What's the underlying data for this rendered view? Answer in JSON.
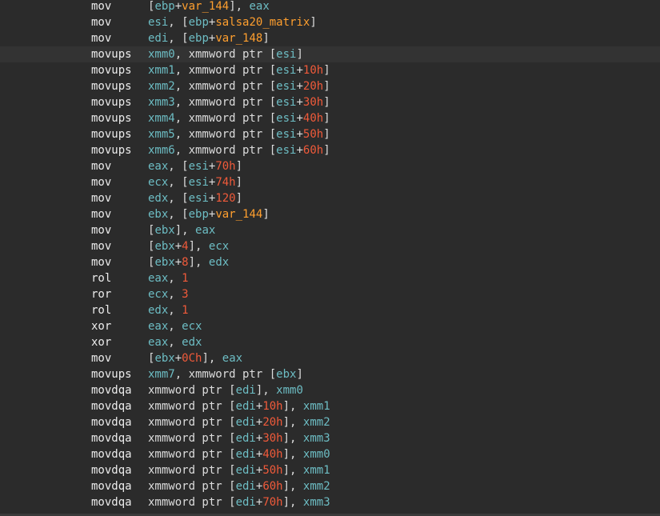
{
  "colors": {
    "background": "#2b2b2b",
    "current_line": "#333333",
    "mnemonic": "#ececec",
    "text": "#dcdcdc",
    "register": "#6dbdc4",
    "variable": "#ff9f2e",
    "number": "#f05a3a"
  },
  "current_line_index": 3,
  "lines": [
    {
      "mnemonic": "mov",
      "tokens": [
        [
          "t",
          "["
        ],
        [
          "r",
          "ebp"
        ],
        [
          "t",
          "+"
        ],
        [
          "v",
          "var_144"
        ],
        [
          "t",
          "], "
        ],
        [
          "r",
          "eax"
        ]
      ]
    },
    {
      "mnemonic": "mov",
      "tokens": [
        [
          "r",
          "esi"
        ],
        [
          "t",
          ", ["
        ],
        [
          "r",
          "ebp"
        ],
        [
          "t",
          "+"
        ],
        [
          "v",
          "salsa20_matrix"
        ],
        [
          "t",
          "]"
        ]
      ]
    },
    {
      "mnemonic": "mov",
      "tokens": [
        [
          "r",
          "edi"
        ],
        [
          "t",
          ", ["
        ],
        [
          "r",
          "ebp"
        ],
        [
          "t",
          "+"
        ],
        [
          "v",
          "var_148"
        ],
        [
          "t",
          "]"
        ]
      ]
    },
    {
      "mnemonic": "movups",
      "tokens": [
        [
          "r",
          "xmm0"
        ],
        [
          "t",
          ", xmmword ptr ["
        ],
        [
          "r",
          "esi"
        ],
        [
          "t",
          "]"
        ]
      ]
    },
    {
      "mnemonic": "movups",
      "tokens": [
        [
          "r",
          "xmm1"
        ],
        [
          "t",
          ", xmmword ptr ["
        ],
        [
          "r",
          "esi"
        ],
        [
          "t",
          "+"
        ],
        [
          "n",
          "10h"
        ],
        [
          "t",
          "]"
        ]
      ]
    },
    {
      "mnemonic": "movups",
      "tokens": [
        [
          "r",
          "xmm2"
        ],
        [
          "t",
          ", xmmword ptr ["
        ],
        [
          "r",
          "esi"
        ],
        [
          "t",
          "+"
        ],
        [
          "n",
          "20h"
        ],
        [
          "t",
          "]"
        ]
      ]
    },
    {
      "mnemonic": "movups",
      "tokens": [
        [
          "r",
          "xmm3"
        ],
        [
          "t",
          ", xmmword ptr ["
        ],
        [
          "r",
          "esi"
        ],
        [
          "t",
          "+"
        ],
        [
          "n",
          "30h"
        ],
        [
          "t",
          "]"
        ]
      ]
    },
    {
      "mnemonic": "movups",
      "tokens": [
        [
          "r",
          "xmm4"
        ],
        [
          "t",
          ", xmmword ptr ["
        ],
        [
          "r",
          "esi"
        ],
        [
          "t",
          "+"
        ],
        [
          "n",
          "40h"
        ],
        [
          "t",
          "]"
        ]
      ]
    },
    {
      "mnemonic": "movups",
      "tokens": [
        [
          "r",
          "xmm5"
        ],
        [
          "t",
          ", xmmword ptr ["
        ],
        [
          "r",
          "esi"
        ],
        [
          "t",
          "+"
        ],
        [
          "n",
          "50h"
        ],
        [
          "t",
          "]"
        ]
      ]
    },
    {
      "mnemonic": "movups",
      "tokens": [
        [
          "r",
          "xmm6"
        ],
        [
          "t",
          ", xmmword ptr ["
        ],
        [
          "r",
          "esi"
        ],
        [
          "t",
          "+"
        ],
        [
          "n",
          "60h"
        ],
        [
          "t",
          "]"
        ]
      ]
    },
    {
      "mnemonic": "mov",
      "tokens": [
        [
          "r",
          "eax"
        ],
        [
          "t",
          ", ["
        ],
        [
          "r",
          "esi"
        ],
        [
          "t",
          "+"
        ],
        [
          "n",
          "70h"
        ],
        [
          "t",
          "]"
        ]
      ]
    },
    {
      "mnemonic": "mov",
      "tokens": [
        [
          "r",
          "ecx"
        ],
        [
          "t",
          ", ["
        ],
        [
          "r",
          "esi"
        ],
        [
          "t",
          "+"
        ],
        [
          "n",
          "74h"
        ],
        [
          "t",
          "]"
        ]
      ]
    },
    {
      "mnemonic": "mov",
      "tokens": [
        [
          "r",
          "edx"
        ],
        [
          "t",
          ", ["
        ],
        [
          "r",
          "esi"
        ],
        [
          "t",
          "+"
        ],
        [
          "n",
          "120"
        ],
        [
          "t",
          "]"
        ]
      ]
    },
    {
      "mnemonic": "mov",
      "tokens": [
        [
          "r",
          "ebx"
        ],
        [
          "t",
          ", ["
        ],
        [
          "r",
          "ebp"
        ],
        [
          "t",
          "+"
        ],
        [
          "v",
          "var_144"
        ],
        [
          "t",
          "]"
        ]
      ]
    },
    {
      "mnemonic": "mov",
      "tokens": [
        [
          "t",
          "["
        ],
        [
          "r",
          "ebx"
        ],
        [
          "t",
          "], "
        ],
        [
          "r",
          "eax"
        ]
      ]
    },
    {
      "mnemonic": "mov",
      "tokens": [
        [
          "t",
          "["
        ],
        [
          "r",
          "ebx"
        ],
        [
          "t",
          "+"
        ],
        [
          "n",
          "4"
        ],
        [
          "t",
          "], "
        ],
        [
          "r",
          "ecx"
        ]
      ]
    },
    {
      "mnemonic": "mov",
      "tokens": [
        [
          "t",
          "["
        ],
        [
          "r",
          "ebx"
        ],
        [
          "t",
          "+"
        ],
        [
          "n",
          "8"
        ],
        [
          "t",
          "], "
        ],
        [
          "r",
          "edx"
        ]
      ]
    },
    {
      "mnemonic": "rol",
      "tokens": [
        [
          "r",
          "eax"
        ],
        [
          "t",
          ", "
        ],
        [
          "n",
          "1"
        ]
      ]
    },
    {
      "mnemonic": "ror",
      "tokens": [
        [
          "r",
          "ecx"
        ],
        [
          "t",
          ", "
        ],
        [
          "n",
          "3"
        ]
      ]
    },
    {
      "mnemonic": "rol",
      "tokens": [
        [
          "r",
          "edx"
        ],
        [
          "t",
          ", "
        ],
        [
          "n",
          "1"
        ]
      ]
    },
    {
      "mnemonic": "xor",
      "tokens": [
        [
          "r",
          "eax"
        ],
        [
          "t",
          ", "
        ],
        [
          "r",
          "ecx"
        ]
      ]
    },
    {
      "mnemonic": "xor",
      "tokens": [
        [
          "r",
          "eax"
        ],
        [
          "t",
          ", "
        ],
        [
          "r",
          "edx"
        ]
      ]
    },
    {
      "mnemonic": "mov",
      "tokens": [
        [
          "t",
          "["
        ],
        [
          "r",
          "ebx"
        ],
        [
          "t",
          "+"
        ],
        [
          "n",
          "0Ch"
        ],
        [
          "t",
          "], "
        ],
        [
          "r",
          "eax"
        ]
      ]
    },
    {
      "mnemonic": "movups",
      "tokens": [
        [
          "r",
          "xmm7"
        ],
        [
          "t",
          ", xmmword ptr ["
        ],
        [
          "r",
          "ebx"
        ],
        [
          "t",
          "]"
        ]
      ]
    },
    {
      "mnemonic": "movdqa",
      "tokens": [
        [
          "t",
          "xmmword ptr ["
        ],
        [
          "r",
          "edi"
        ],
        [
          "t",
          "], "
        ],
        [
          "r",
          "xmm0"
        ]
      ]
    },
    {
      "mnemonic": "movdqa",
      "tokens": [
        [
          "t",
          "xmmword ptr ["
        ],
        [
          "r",
          "edi"
        ],
        [
          "t",
          "+"
        ],
        [
          "n",
          "10h"
        ],
        [
          "t",
          "], "
        ],
        [
          "r",
          "xmm1"
        ]
      ]
    },
    {
      "mnemonic": "movdqa",
      "tokens": [
        [
          "t",
          "xmmword ptr ["
        ],
        [
          "r",
          "edi"
        ],
        [
          "t",
          "+"
        ],
        [
          "n",
          "20h"
        ],
        [
          "t",
          "], "
        ],
        [
          "r",
          "xmm2"
        ]
      ]
    },
    {
      "mnemonic": "movdqa",
      "tokens": [
        [
          "t",
          "xmmword ptr ["
        ],
        [
          "r",
          "edi"
        ],
        [
          "t",
          "+"
        ],
        [
          "n",
          "30h"
        ],
        [
          "t",
          "], "
        ],
        [
          "r",
          "xmm3"
        ]
      ]
    },
    {
      "mnemonic": "movdqa",
      "tokens": [
        [
          "t",
          "xmmword ptr ["
        ],
        [
          "r",
          "edi"
        ],
        [
          "t",
          "+"
        ],
        [
          "n",
          "40h"
        ],
        [
          "t",
          "], "
        ],
        [
          "r",
          "xmm0"
        ]
      ]
    },
    {
      "mnemonic": "movdqa",
      "tokens": [
        [
          "t",
          "xmmword ptr ["
        ],
        [
          "r",
          "edi"
        ],
        [
          "t",
          "+"
        ],
        [
          "n",
          "50h"
        ],
        [
          "t",
          "], "
        ],
        [
          "r",
          "xmm1"
        ]
      ]
    },
    {
      "mnemonic": "movdqa",
      "tokens": [
        [
          "t",
          "xmmword ptr ["
        ],
        [
          "r",
          "edi"
        ],
        [
          "t",
          "+"
        ],
        [
          "n",
          "60h"
        ],
        [
          "t",
          "], "
        ],
        [
          "r",
          "xmm2"
        ]
      ]
    },
    {
      "mnemonic": "movdqa",
      "tokens": [
        [
          "t",
          "xmmword ptr ["
        ],
        [
          "r",
          "edi"
        ],
        [
          "t",
          "+"
        ],
        [
          "n",
          "70h"
        ],
        [
          "t",
          "], "
        ],
        [
          "r",
          "xmm3"
        ]
      ]
    }
  ]
}
